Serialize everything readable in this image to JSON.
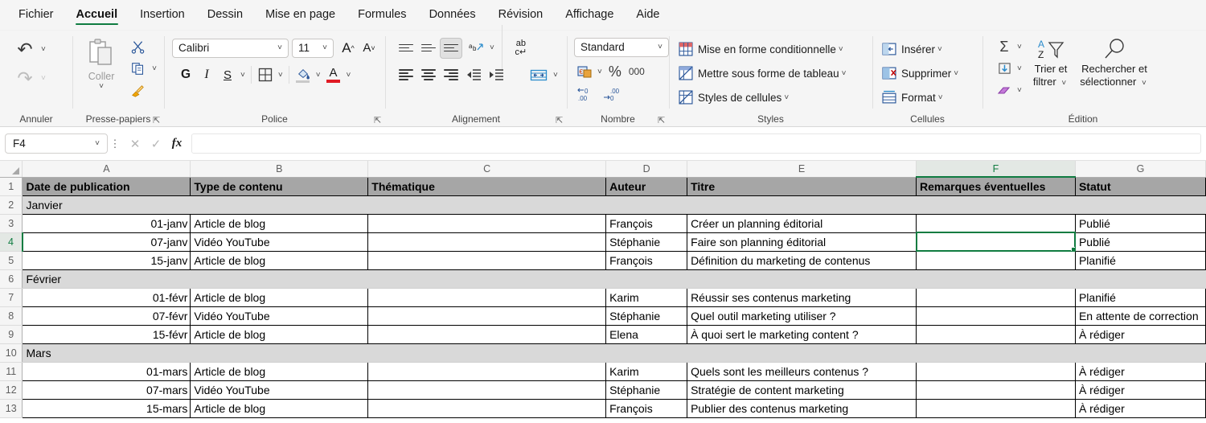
{
  "tabs": [
    {
      "label": "Fichier",
      "active": false
    },
    {
      "label": "Accueil",
      "active": true
    },
    {
      "label": "Insertion",
      "active": false
    },
    {
      "label": "Dessin",
      "active": false
    },
    {
      "label": "Mise en page",
      "active": false
    },
    {
      "label": "Formules",
      "active": false
    },
    {
      "label": "Données",
      "active": false
    },
    {
      "label": "Révision",
      "active": false
    },
    {
      "label": "Affichage",
      "active": false
    },
    {
      "label": "Aide",
      "active": false
    }
  ],
  "ribbon": {
    "groups": {
      "undo": {
        "label": "Annuler"
      },
      "clipboard": {
        "label": "Presse-papiers",
        "paste_label": "Coller"
      },
      "font": {
        "label": "Police",
        "font_name": "Calibri",
        "font_size": "11",
        "grow_label": "A",
        "shrink_label": "A",
        "bold_label": "G",
        "italic_label": "I",
        "underline_label": "S"
      },
      "alignment": {
        "label": "Alignement",
        "wrap_label": "ab",
        "merge_label": ""
      },
      "number": {
        "label": "Nombre",
        "format": "Standard",
        "percent_label": "%",
        "thousands_label": "000",
        "dec_inc_label": ".00",
        "dec_dec_label": ".00"
      },
      "styles": {
        "label": "Styles",
        "items": [
          "Mise en forme conditionnelle",
          "Mettre sous forme de tableau",
          "Styles de cellules"
        ]
      },
      "cells": {
        "label": "Cellules",
        "items": [
          "Insérer",
          "Supprimer",
          "Format"
        ]
      },
      "editing": {
        "label": "Édition",
        "sort_label_line1": "Trier et",
        "sort_label_line2": "filtrer",
        "find_label_line1": "Rechercher et",
        "find_label_line2": "sélectionner"
      }
    }
  },
  "formula_bar": {
    "name_box": "F4",
    "formula": "",
    "cancel_icon": "✕",
    "confirm_icon": "✓",
    "fx_icon": "fx"
  },
  "sheet": {
    "column_headers": [
      "A",
      "B",
      "C",
      "D",
      "E",
      "F",
      "G"
    ],
    "selected_column": "F",
    "selected_row": 4,
    "selected_cell": "F4",
    "row_numbers": [
      1,
      2,
      3,
      4,
      5,
      6,
      7,
      8,
      9,
      10,
      11,
      12,
      13
    ],
    "rows": [
      {
        "n": 1,
        "type": "header",
        "cells": [
          "Date de publication",
          "Type de contenu",
          "Thématique",
          "Auteur",
          "Titre",
          "Remarques éventuelles",
          "Statut"
        ]
      },
      {
        "n": 2,
        "type": "band",
        "cells": [
          "Janvier",
          "",
          "",
          "",
          "",
          "",
          ""
        ]
      },
      {
        "n": 3,
        "type": "data",
        "cells": [
          "01-janv",
          "Article de blog",
          "",
          "François",
          "Créer un planning éditorial",
          "",
          "Publié"
        ]
      },
      {
        "n": 4,
        "type": "data",
        "cells": [
          "07-janv",
          "Vidéo YouTube",
          "",
          "Stéphanie",
          "Faire son planning éditorial",
          "",
          "Publié"
        ]
      },
      {
        "n": 5,
        "type": "data",
        "cells": [
          "15-janv",
          "Article de blog",
          "",
          "François",
          "Définition du marketing de contenus",
          "",
          "Planifié"
        ]
      },
      {
        "n": 6,
        "type": "band",
        "cells": [
          "Février",
          "",
          "",
          "",
          "",
          "",
          ""
        ]
      },
      {
        "n": 7,
        "type": "data",
        "cells": [
          "01-févr",
          "Article de blog",
          "",
          "Karim",
          "Réussir ses contenus marketing",
          "",
          "Planifié"
        ]
      },
      {
        "n": 8,
        "type": "data",
        "cells": [
          "07-févr",
          "Vidéo YouTube",
          "",
          "Stéphanie",
          "Quel outil marketing utiliser ?",
          "",
          "En attente de correction"
        ]
      },
      {
        "n": 9,
        "type": "data",
        "cells": [
          "15-févr",
          "Article de blog",
          "",
          "Elena",
          "À quoi sert le marketing content ?",
          "",
          "À rédiger"
        ]
      },
      {
        "n": 10,
        "type": "band",
        "cells": [
          "Mars",
          "",
          "",
          "",
          "",
          "",
          ""
        ]
      },
      {
        "n": 11,
        "type": "data",
        "cells": [
          "01-mars",
          "Article de blog",
          "",
          "Karim",
          "Quels sont les meilleurs contenus ?",
          "",
          "À rédiger"
        ]
      },
      {
        "n": 12,
        "type": "data",
        "cells": [
          "07-mars",
          "Vidéo YouTube",
          "",
          "Stéphanie",
          "Stratégie de content marketing",
          "",
          "À rédiger"
        ]
      },
      {
        "n": 13,
        "type": "data",
        "cells": [
          "15-mars",
          "Article de blog",
          "",
          "François",
          "Publier des contenus marketing",
          "",
          "À rédiger"
        ]
      }
    ]
  },
  "colors": {
    "accent_green": "#107c41",
    "header_fill": "#a6a6a6",
    "band_fill": "#d9d9d9",
    "ribbon_bg": "#f5f5f5"
  }
}
